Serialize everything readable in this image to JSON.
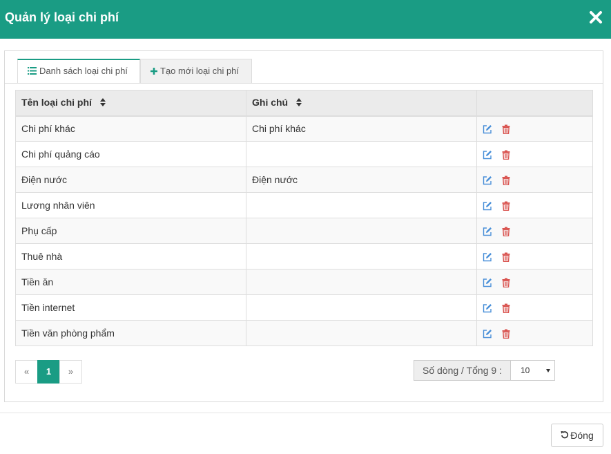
{
  "modal": {
    "title": "Quản lý loại chi phí",
    "close_icon": "close-icon"
  },
  "tabs": [
    {
      "label": "Danh sách loại chi phí",
      "icon": "list-icon",
      "active": true
    },
    {
      "label": "Tạo mới loại chi phí",
      "icon": "plus-icon",
      "active": false
    }
  ],
  "table": {
    "columns": [
      "Tên loại chi phí",
      "Ghi chú",
      ""
    ],
    "rows": [
      {
        "name": "Chi phí khác",
        "note": "Chi phí khác"
      },
      {
        "name": "Chi phí quảng cáo",
        "note": ""
      },
      {
        "name": "Điện nước",
        "note": "Điện nước"
      },
      {
        "name": "Lương nhân viên",
        "note": ""
      },
      {
        "name": "Phụ cấp",
        "note": ""
      },
      {
        "name": "Thuê nhà",
        "note": ""
      },
      {
        "name": "Tiền ăn",
        "note": ""
      },
      {
        "name": "Tiền internet",
        "note": ""
      },
      {
        "name": "Tiền văn phòng phẩm",
        "note": ""
      }
    ]
  },
  "pagination": {
    "prev": "«",
    "current": "1",
    "next": "»"
  },
  "page_size": {
    "label": "Số dòng / Tổng 9 :",
    "value": "10"
  },
  "footer": {
    "close_label": "Đóng"
  },
  "colors": {
    "primary": "#1a9c84",
    "edit": "#4a90d9",
    "delete": "#d9534f"
  }
}
